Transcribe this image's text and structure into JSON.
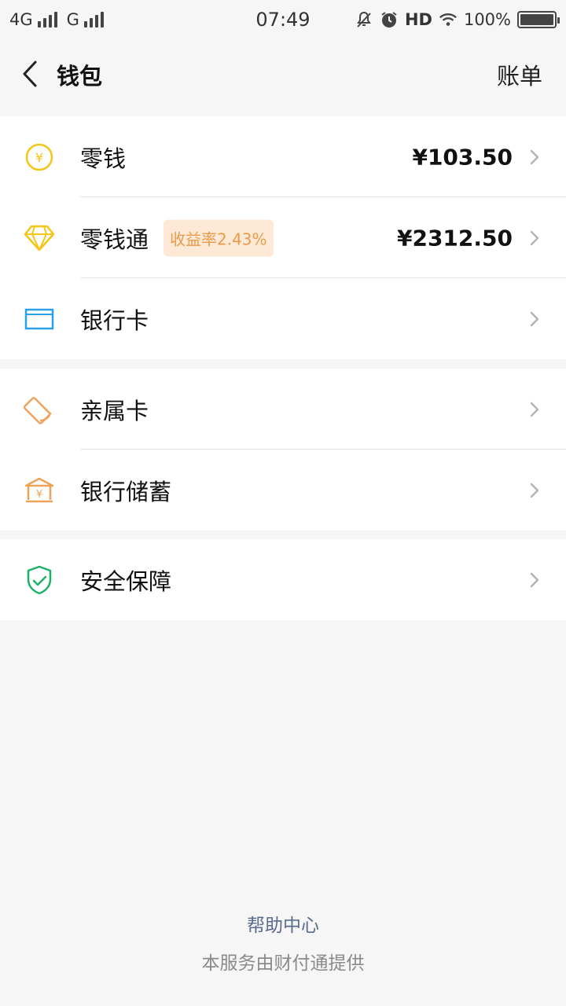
{
  "status_bar": {
    "network1": "4G",
    "network2": "G",
    "time": "07:49",
    "hd": "HD",
    "battery": "100%",
    "icons": [
      "signal-icon",
      "mute-bell-icon",
      "alarm-icon",
      "wifi-icon",
      "battery-icon"
    ]
  },
  "header": {
    "title": "钱包",
    "bill": "账单"
  },
  "section1": {
    "items": [
      {
        "label": "零钱",
        "value": "¥103.50",
        "icon": "yuan-coin-icon",
        "color": "#f5c518"
      },
      {
        "label": "零钱通",
        "badge": "收益率2.43%",
        "value": "¥2312.50",
        "icon": "diamond-icon",
        "color": "#f5c518"
      },
      {
        "label": "银行卡",
        "icon": "bank-card-icon",
        "color": "#29a1e6"
      }
    ]
  },
  "section2": {
    "items": [
      {
        "label": "亲属卡",
        "icon": "family-card-icon",
        "color": "#eda35a"
      },
      {
        "label": "银行储蓄",
        "icon": "bank-savings-icon",
        "color": "#eda35a"
      }
    ]
  },
  "section3": {
    "items": [
      {
        "label": "安全保障",
        "icon": "shield-check-icon",
        "color": "#1db168"
      }
    ]
  },
  "footer": {
    "help": "帮助中心",
    "provider": "本服务由财付通提供"
  }
}
